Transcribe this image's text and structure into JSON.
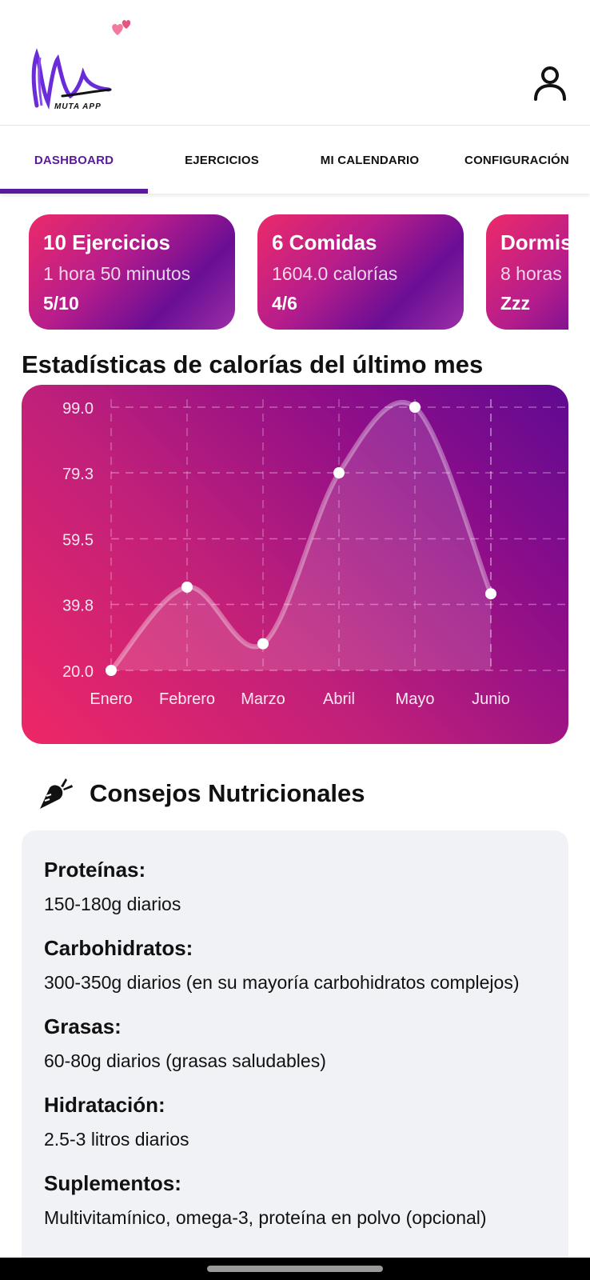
{
  "app": {
    "logo_text": "MUTA APP"
  },
  "header": {
    "user_icon": "user-icon",
    "hearts_icon": "hearts-icon"
  },
  "tabs": [
    {
      "label": "DASHBOARD",
      "active": true
    },
    {
      "label": "EJERCICIOS",
      "active": false
    },
    {
      "label": "MI CALENDARIO",
      "active": false
    },
    {
      "label": "CONFIGURACIÓN",
      "active": false
    }
  ],
  "cards": [
    {
      "title": "10 Ejercicios",
      "subtitle": "1 hora 50 minutos",
      "progress": "5/10"
    },
    {
      "title": "6 Comidas",
      "subtitle": "1604.0 calorías",
      "progress": "4/6"
    },
    {
      "title": "Dormis",
      "subtitle": "8 horas",
      "progress": "Zzz"
    }
  ],
  "stats": {
    "title": "Estadísticas de calorías del último mes"
  },
  "chart_data": {
    "type": "line",
    "title": "",
    "categories": [
      "Enero",
      "Febrero",
      "Marzo",
      "Abril",
      "Mayo",
      "Junio"
    ],
    "series": [
      {
        "values": [
          20.0,
          45.0,
          28.0,
          79.3,
          99.0,
          43.0
        ]
      }
    ],
    "yticks": [
      "99.0",
      "79.3",
      "59.5",
      "39.8",
      "20.0"
    ],
    "ylim": [
      20.0,
      99.0
    ],
    "grid": true,
    "line_color": "#ffffff"
  },
  "nutrition": {
    "title": "Consejos Nutricionales",
    "icon": "carrot-icon",
    "items": [
      {
        "label": "Proteínas:",
        "value": "150-180g diarios"
      },
      {
        "label": "Carbohidratos:",
        "value": "300-350g diarios (en su mayoría carbohidratos complejos)"
      },
      {
        "label": "Grasas:",
        "value": "60-80g diarios (grasas saludables)"
      },
      {
        "label": "Hidratación:",
        "value": "2.5-3 litros diarios"
      },
      {
        "label": "Suplementos:",
        "value": "Multivitamínico, omega-3, proteína en polvo (opcional)"
      }
    ]
  },
  "colors": {
    "accent": "#5b1a9c",
    "gradient_start": "#ec2a6a",
    "gradient_end": "#6a0e95"
  }
}
